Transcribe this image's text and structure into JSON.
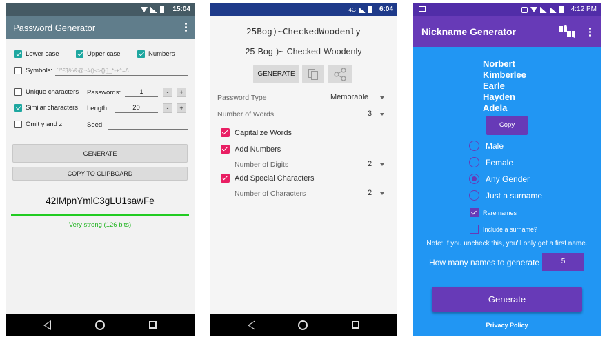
{
  "phone1": {
    "status_time": "15:04",
    "title": "Password Generator",
    "options": {
      "lower_case": "Lower case",
      "upper_case": "Upper case",
      "numbers": "Numbers",
      "symbols_label": "Symbols:",
      "symbols_value": "`!\"£$%&@~#()<>{}[]_*-+^=/\\",
      "unique_chars": "Unique characters",
      "similar_chars": "Similar characters",
      "omit_yz": "Omit y and z",
      "passwords_label": "Passwords:",
      "passwords_value": "1",
      "length_label": "Length:",
      "length_value": "20",
      "seed_label": "Seed:",
      "minus": "-",
      "plus": "+"
    },
    "checks": {
      "lower_case": true,
      "upper_case": true,
      "numbers": true,
      "symbols": false,
      "unique_chars": false,
      "similar_chars": true,
      "omit_yz": false
    },
    "generate_label": "GENERATE",
    "copy_label": "COPY TO CLIPBOARD",
    "password": "42IMpnYmlC3gLU1sawFe",
    "strength_text": "Very strong (126 bits)",
    "strength_color": "#22cc22",
    "strength_fraction": 1.0
  },
  "phone2": {
    "status_time": "6:04",
    "status_network": "4G",
    "password_mono": "25Bog)~CheckedWoodenly",
    "password_memorable": "25-Bog-)~-Checked-Woodenly",
    "generate_label": "GENERATE",
    "copy_icon": "copy-icon",
    "share_icon": "share-icon",
    "password_type_label": "Password Type",
    "password_type_value": "Memorable",
    "num_words_label": "Number of Words",
    "num_words_value": "3",
    "capitalize_words": "Capitalize Words",
    "add_numbers": "Add Numbers",
    "num_digits_label": "Number of Digits",
    "num_digits_value": "2",
    "add_special": "Add Special Characters",
    "num_chars_label": "Number of Characters",
    "num_chars_value": "2",
    "accent_color": "#e91e63"
  },
  "phone3": {
    "status_time": "4:12 PM",
    "title": "Nickname Generator",
    "names": [
      "Norbert",
      "Kimberlee",
      "Earle",
      "Hayden",
      "Adela"
    ],
    "copy_label": "Copy",
    "gender_options": [
      "Male",
      "Female",
      "Any Gender",
      "Just a surname"
    ],
    "selected_gender": "Any Gender",
    "rare_names": "Rare names",
    "rare_names_checked": true,
    "include_surname": "Include a surname?",
    "include_surname_checked": false,
    "note": "Note: If you uncheck this, you'll only get a first name.",
    "how_many_label": "How many names to generate",
    "how_many_value": "5",
    "generate_label": "Generate",
    "privacy_label": "Privacy Policy",
    "accent_color": "#673ab7"
  }
}
